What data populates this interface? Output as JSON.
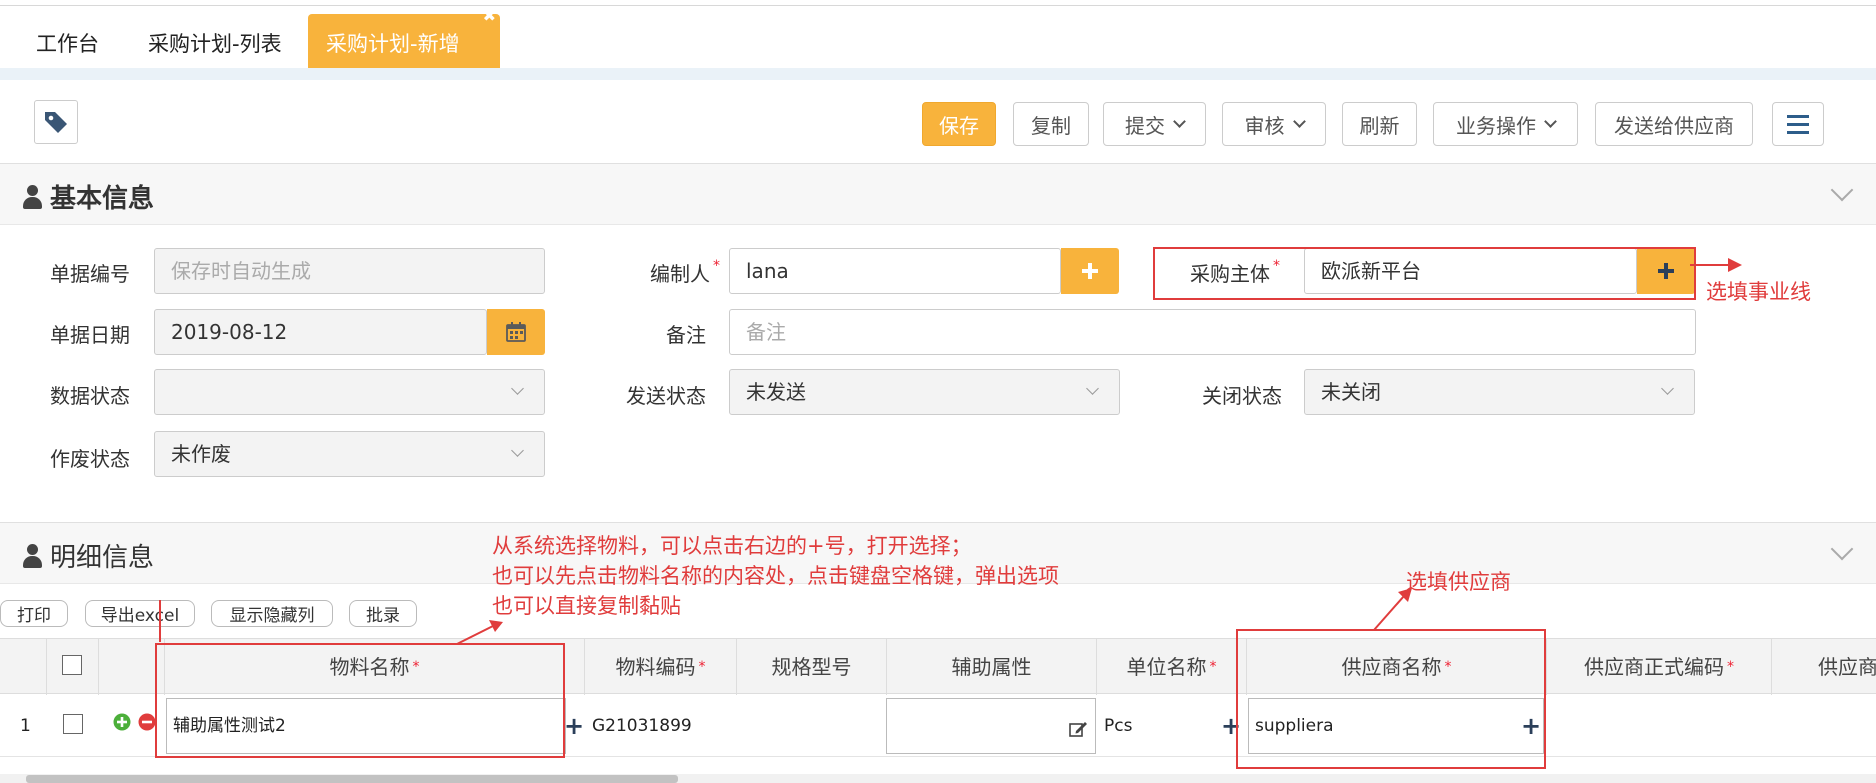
{
  "tabs": [
    {
      "label": "工作台"
    },
    {
      "label": "采购计划-列表"
    },
    {
      "label": "采购计划-新增",
      "active": true
    }
  ],
  "toolbar": {
    "save": "保存",
    "copy": "复制",
    "submit": "提交",
    "audit": "审核",
    "refresh": "刷新",
    "business": "业务操作",
    "send_supplier": "发送给供应商"
  },
  "basic": {
    "title": "基本信息",
    "doc_no_label": "单据编号",
    "doc_no_placeholder": "保存时自动生成",
    "editor_label": "编制人",
    "editor_value": "lana",
    "subject_label": "采购主体",
    "subject_value": "欧派新平台",
    "date_label": "单据日期",
    "date_value": "2019-08-12",
    "remark_label": "备注",
    "remark_placeholder": "备注",
    "data_status_label": "数据状态",
    "data_status_value": "",
    "send_status_label": "发送状态",
    "send_status_value": "未发送",
    "close_status_label": "关闭状态",
    "close_status_value": "未关闭",
    "void_status_label": "作废状态",
    "void_status_value": "未作废"
  },
  "detail": {
    "title": "明细信息",
    "print": "打印",
    "export": "导出excel",
    "show_hidden": "显示隐藏列",
    "batch": "批录",
    "columns": {
      "material_name": "物料名称",
      "material_code": "物料编码",
      "spec": "规格型号",
      "aux": "辅助属性",
      "unit": "单位名称",
      "supplier_name": "供应商名称",
      "supplier_code": "供应商正式编码",
      "supplier_more": "供应商"
    },
    "rows": [
      {
        "index": "1",
        "material_name": "辅助属性测试2",
        "material_code": "G21031899",
        "spec": "",
        "aux": "",
        "unit": "Pcs",
        "supplier_name": "suppliera"
      }
    ]
  },
  "annotations": {
    "subject_note": "选填事业线",
    "material_note_1": "从系统选择物料，可以点击右边的+号，打开选择；",
    "material_note_2": "也可以先点击物料名称的内容处，点击键盘空格键，弹出选项",
    "material_note_3": "也可以直接复制黏贴",
    "supplier_note": "选填供应商"
  },
  "colors": {
    "accent": "#f8b33c",
    "annotation": "#e03c3c"
  }
}
